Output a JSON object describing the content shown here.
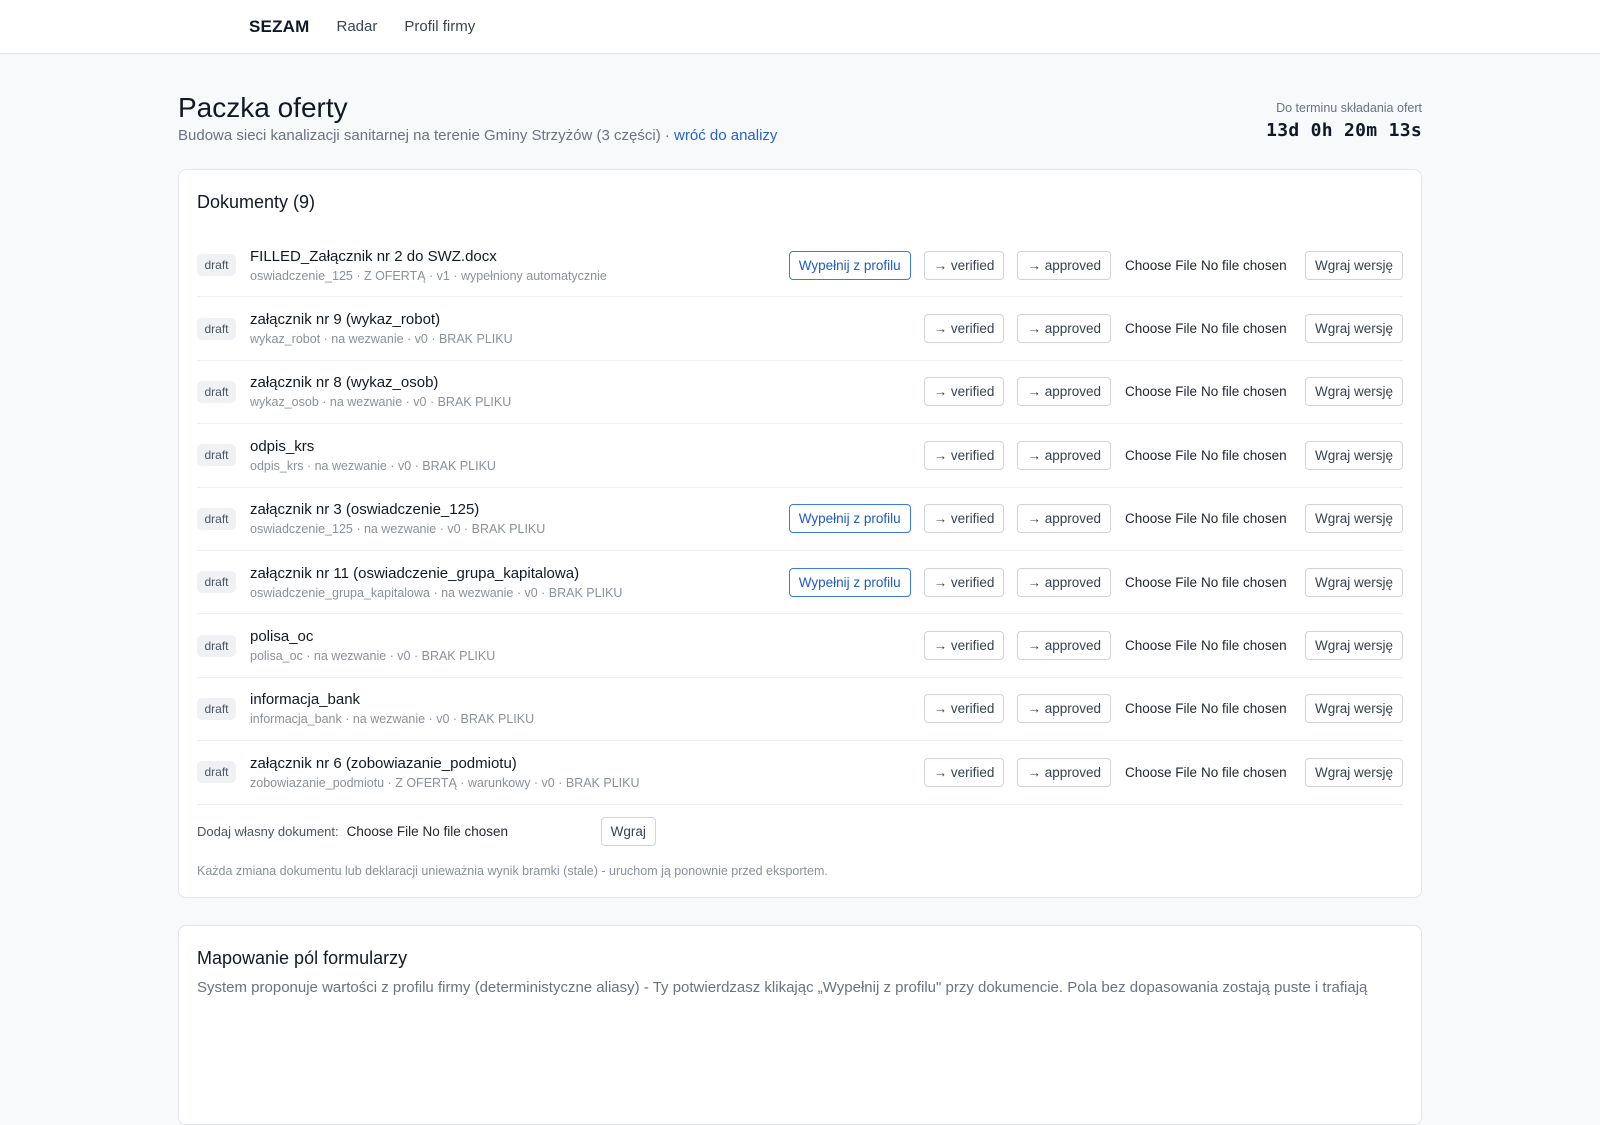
{
  "nav": {
    "brand": "SEZAM",
    "links": [
      "Radar",
      "Profil firmy"
    ]
  },
  "header": {
    "title": "Paczka oferty",
    "subtitle": "Budowa sieci kanalizacji sanitarnej na terenie Gminy Strzyżów (3 części) · ",
    "back_link": "wróć do analizy",
    "deadline_label": "Do terminu składania ofert",
    "deadline_value": "13d 0h 20m 13s"
  },
  "documents": {
    "title": "Dokumenty (9)",
    "labels": {
      "fill": "Wypełnij z profilu",
      "verified": "→ verified",
      "approved": "→ approved",
      "choose_file": "Choose File",
      "no_file": "No file chosen",
      "upload": "Wgraj wersję"
    },
    "rows": [
      {
        "status": "draft",
        "name": "FILLED_Załącznik nr 2 do SWZ.docx",
        "meta": "oswiadczenie_125 · Z OFERTĄ · v1 · wypełniony automatycznie",
        "fill": true
      },
      {
        "status": "draft",
        "name": "załącznik nr 9 (wykaz_robot)",
        "meta": "wykaz_robot · na wezwanie · v0 · BRAK PLIKU",
        "fill": false
      },
      {
        "status": "draft",
        "name": "załącznik nr 8 (wykaz_osob)",
        "meta": "wykaz_osob · na wezwanie · v0 · BRAK PLIKU",
        "fill": false
      },
      {
        "status": "draft",
        "name": "odpis_krs",
        "meta": "odpis_krs · na wezwanie · v0 · BRAK PLIKU",
        "fill": false
      },
      {
        "status": "draft",
        "name": "załącznik nr 3 (oswiadczenie_125)",
        "meta": "oswiadczenie_125 · na wezwanie · v0 · BRAK PLIKU",
        "fill": true
      },
      {
        "status": "draft",
        "name": "załącznik nr 11 (oswiadczenie_grupa_kapitalowa)",
        "meta": "oswiadczenie_grupa_kapitalowa · na wezwanie · v0 · BRAK PLIKU",
        "fill": true
      },
      {
        "status": "draft",
        "name": "polisa_oc",
        "meta": "polisa_oc · na wezwanie · v0 · BRAK PLIKU",
        "fill": false
      },
      {
        "status": "draft",
        "name": "informacja_bank",
        "meta": "informacja_bank · na wezwanie · v0 · BRAK PLIKU",
        "fill": false
      },
      {
        "status": "draft",
        "name": "załącznik nr 6 (zobowiazanie_podmiotu)",
        "meta": "zobowiazanie_podmiotu · Z OFERTĄ · warunkowy · v0 · BRAK PLIKU",
        "fill": false
      }
    ],
    "add": {
      "label": "Dodaj własny dokument:",
      "choose_file": "Choose File",
      "no_file": "No file chosen",
      "upload": "Wgraj"
    },
    "note": "Każda zmiana dokumentu lub deklaracji unieważnia wynik bramki (stale) - uruchom ją ponownie przed eksportem."
  },
  "mapping": {
    "title": "Mapowanie pól formularzy",
    "description": "System proponuje wartości z profilu firmy (deterministyczne aliasy) - Ty potwierdzasz klikając „Wypełnij z profilu\" przy dokumencie. Pola bez dopasowania zostają puste i trafiają"
  }
}
